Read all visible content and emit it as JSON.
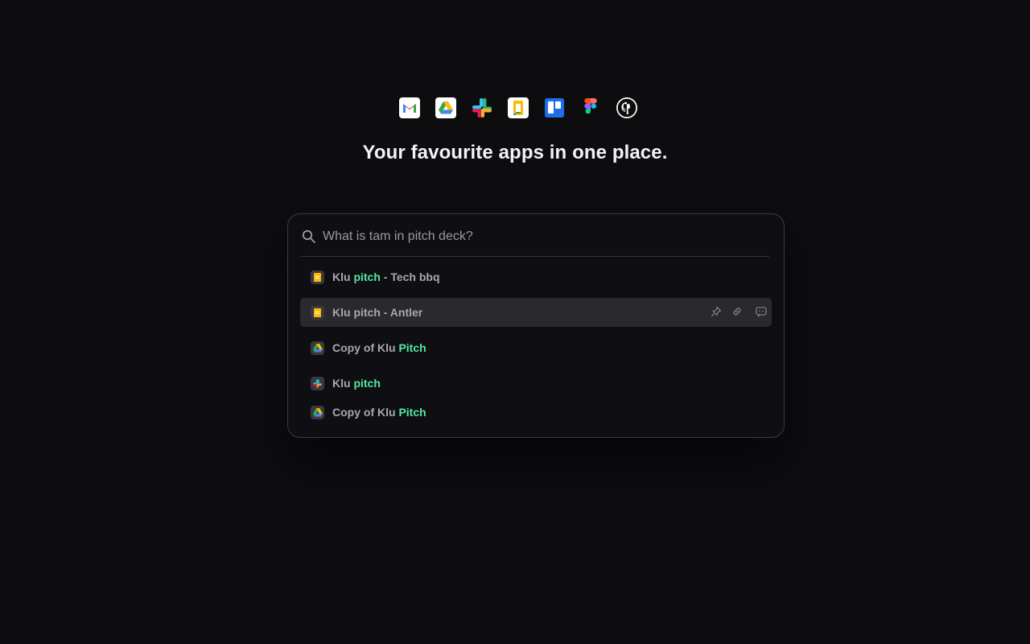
{
  "apps": [
    {
      "name": "gmail-icon"
    },
    {
      "name": "google-drive-icon"
    },
    {
      "name": "slack-icon"
    },
    {
      "name": "google-keep-icon"
    },
    {
      "name": "trello-icon"
    },
    {
      "name": "figma-icon"
    },
    {
      "name": "github-icon"
    }
  ],
  "headline": "Your favourite apps in one place.",
  "search": {
    "placeholder": "What is tam in pitch deck?",
    "value": ""
  },
  "results": [
    {
      "icon": "google-doc-icon",
      "prefix": "Klu ",
      "highlight": "pitch",
      "suffix": " - Tech bbq",
      "active": false
    },
    {
      "icon": "google-doc-icon",
      "prefix": "Klu pitch - Antler",
      "highlight": "",
      "suffix": "",
      "active": true
    },
    {
      "icon": "google-drive-icon",
      "prefix": "Copy of Klu ",
      "highlight": "Pitch",
      "suffix": "",
      "active": false
    },
    {
      "icon": "slack-icon",
      "prefix": "Klu ",
      "highlight": "pitch",
      "suffix": "",
      "active": false
    },
    {
      "icon": "google-drive-icon",
      "prefix": "Copy of Klu ",
      "highlight": "Pitch",
      "suffix": "",
      "active": false
    }
  ],
  "colors": {
    "background": "#0d0c0f",
    "highlight": "#52e8a4",
    "active_row": "#2a292e"
  }
}
